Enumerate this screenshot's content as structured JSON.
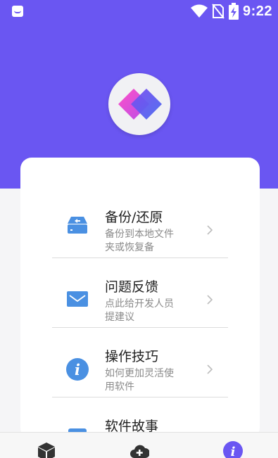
{
  "colors": {
    "primary": "#6a56f2",
    "accent_blue": "#4a90e2",
    "logo_pink": "#e94bd6",
    "logo_blue": "#5a5cf0"
  },
  "status_bar": {
    "time": "9:22",
    "icons": [
      "notification-app-icon",
      "wifi-icon",
      "no-sim-icon",
      "battery-charging-icon"
    ]
  },
  "app_logo": {
    "icon": "app-logo-diamonds-icon"
  },
  "menu": {
    "items": [
      {
        "title": "备份/还原",
        "description": "备份到本地文件夹或恢复备",
        "icon": "backup-drive-icon"
      },
      {
        "title": "问题反馈",
        "description": "点此给开发人员提建议",
        "icon": "mail-icon"
      },
      {
        "title": "操作技巧",
        "description": "如何更加灵活使用软件",
        "icon": "info-icon"
      },
      {
        "title": "软件故事",
        "description": "",
        "icon": "document-icon"
      }
    ]
  },
  "bottom_nav": {
    "tabs": [
      {
        "icon": "box-icon",
        "active": false
      },
      {
        "icon": "cloud-add-icon",
        "active": false
      },
      {
        "icon": "info-icon",
        "active": true
      }
    ]
  }
}
